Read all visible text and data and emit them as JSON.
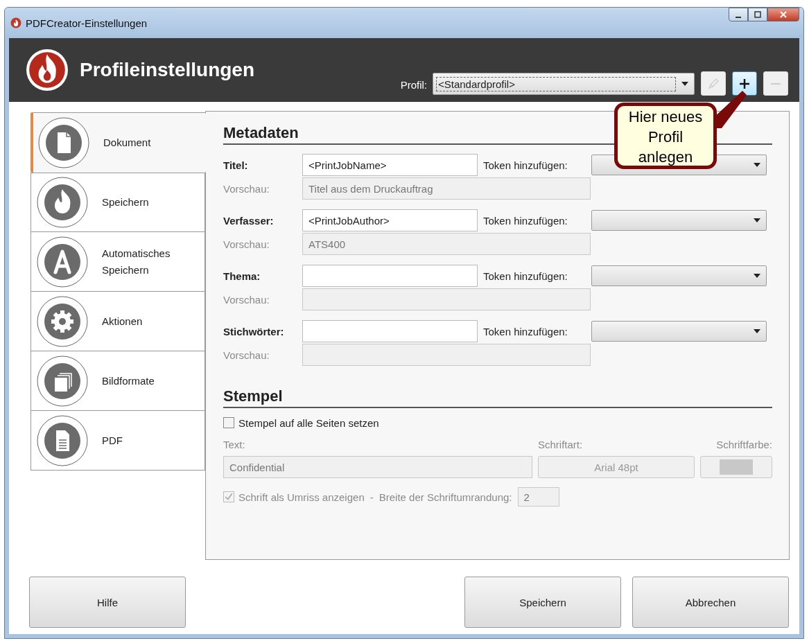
{
  "window": {
    "title": "PDFCreator-Einstellungen"
  },
  "header": {
    "title": "Profileinstellungen",
    "profile_label": "Profil:",
    "profile_value": "<Standardprofil>",
    "buttons": [
      {
        "kind": "edit",
        "disabled": true
      },
      {
        "kind": "add",
        "disabled": false
      },
      {
        "kind": "remove",
        "disabled": true
      }
    ]
  },
  "callout": {
    "text": "Hier neues Profil anlegen"
  },
  "sidebar": {
    "items": [
      {
        "label": "Dokument",
        "kind": "document",
        "selected": true
      },
      {
        "label": "Speichern",
        "kind": "flame",
        "selected": false
      },
      {
        "label": "Automatisches Speichern",
        "kind": "letter",
        "selected": false
      },
      {
        "label": "Aktionen",
        "kind": "gear",
        "selected": false
      },
      {
        "label": "Bildformate",
        "kind": "stack",
        "selected": false
      },
      {
        "label": "PDF",
        "kind": "pdf",
        "selected": false
      }
    ]
  },
  "metadata": {
    "heading": "Metadaten",
    "fields": [
      {
        "label": "Titel:",
        "value": "<PrintJobName>",
        "token_label": "Token hinzufügen:",
        "preview_label": "Vorschau:",
        "preview": "Titel aus dem Druckauftrag"
      },
      {
        "label": "Verfasser:",
        "value": "<PrintJobAuthor>",
        "token_label": "Token hinzufügen:",
        "preview_label": "Vorschau:",
        "preview": "ATS400"
      },
      {
        "label": "Thema:",
        "token_label": "Token hinzufügen:",
        "preview_label": "Vorschau:"
      },
      {
        "label": "Stichwörter:",
        "token_label": "Token hinzufügen:",
        "preview_label": "Vorschau:"
      }
    ]
  },
  "stamp": {
    "heading": "Stempel",
    "enable": {
      "label": "Stempel auf alle Seiten setzen",
      "checked": false
    },
    "text_label": "Text:",
    "text_value": "Confidential",
    "font_label": "Schriftart:",
    "font_value": "Arial 48pt",
    "color_label": "Schriftfarbe:",
    "outline": {
      "label": "Schrift als Umriss anzeigen",
      "checked": true,
      "disabled": true
    },
    "separator": "-",
    "width_label": "Breite der Schriftumrandung:",
    "width_value": "2"
  },
  "buttons": [
    {
      "label": "Hilfe"
    },
    {
      "label": "Speichern"
    },
    {
      "label": "Abbrechen"
    }
  ]
}
